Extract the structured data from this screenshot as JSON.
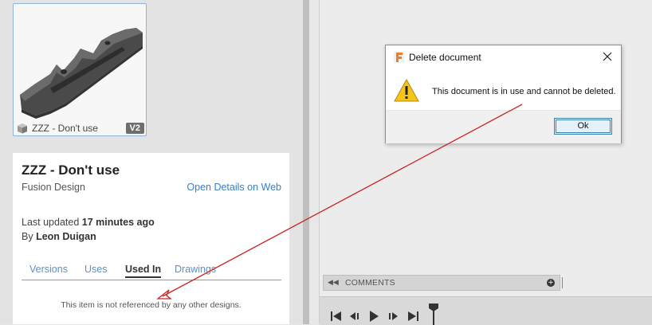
{
  "colors": {
    "accent_link": "#3a7fc4",
    "tab_inactive": "#5b8fc4",
    "selection_border": "#8fb5d8",
    "annotation_arrow": "#cc2222",
    "dialog_button_border": "#3c7fb1"
  },
  "thumbnail": {
    "name": "ZZZ - Don't use",
    "version": "V2",
    "icon": "design-cube-icon"
  },
  "details": {
    "title": "ZZZ - Don't use",
    "type": "Fusion Design",
    "open_link": "Open Details on Web",
    "last_updated_prefix": "Last updated",
    "last_updated_value": "17 minutes ago",
    "by_prefix": "By",
    "author": "Leon Duigan",
    "tabs": [
      {
        "label": "Versions"
      },
      {
        "label": "Uses"
      },
      {
        "label": "Used In"
      },
      {
        "label": "Drawings"
      }
    ],
    "active_tab": "Used In",
    "empty_message": "This item is not referenced by any other designs."
  },
  "comments": {
    "label": "COMMENTS",
    "collapse_icon": "double-chevron-left-icon",
    "add_icon": "plus-circle-icon"
  },
  "timeline": {
    "buttons": [
      "skip-to-start-icon",
      "step-back-icon",
      "play-icon",
      "step-forward-icon",
      "skip-to-end-icon"
    ],
    "marker_icon": "timeline-marker-icon"
  },
  "dialog": {
    "title": "Delete document",
    "app_icon": "fusion-f-icon",
    "close_icon": "close-icon",
    "warning_icon": "warning-icon",
    "message": "This document is in use and cannot be deleted.",
    "ok_label": "Ok"
  }
}
